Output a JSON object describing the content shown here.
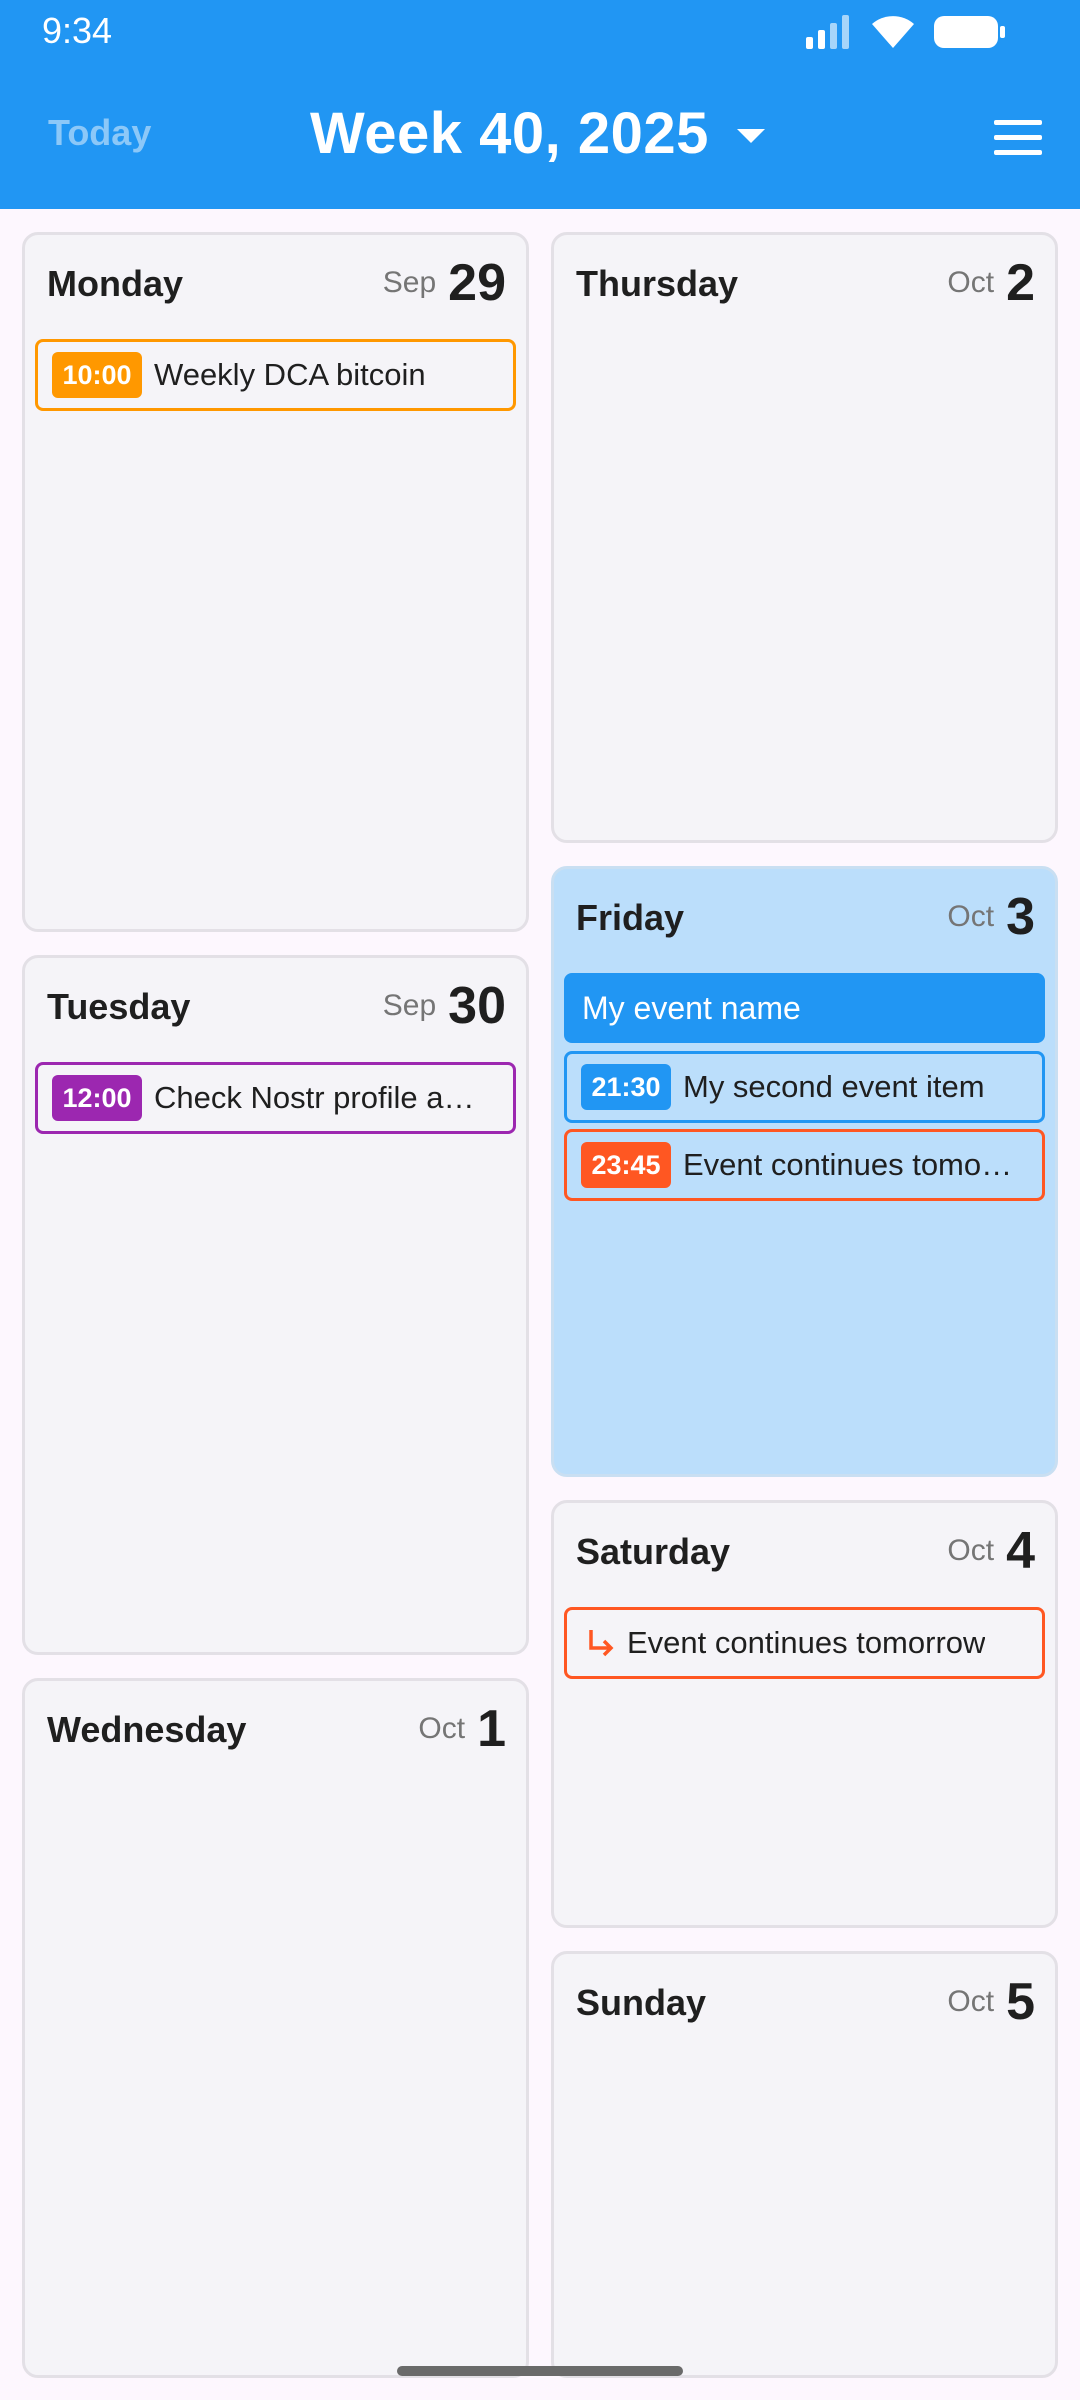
{
  "status_bar": {
    "time": "9:34"
  },
  "header": {
    "today_label": "Today",
    "week_title": "Week 40, 2025",
    "accent_color": "#2196f3"
  },
  "days": [
    {
      "name": "Monday",
      "month": "Sep",
      "day": "29",
      "events": [
        {
          "time": "10:00",
          "title": "Weekly DCA bitcoin",
          "color": "#ff9800"
        }
      ]
    },
    {
      "name": "Tuesday",
      "month": "Sep",
      "day": "30",
      "events": [
        {
          "time": "12:00",
          "title": "Check Nostr profile a…",
          "color": "#9c27b0"
        }
      ]
    },
    {
      "name": "Wednesday",
      "month": "Oct",
      "day": "1",
      "events": []
    },
    {
      "name": "Thursday",
      "month": "Oct",
      "day": "2",
      "events": []
    },
    {
      "name": "Friday",
      "month": "Oct",
      "day": "3",
      "is_today": true,
      "events": [
        {
          "all_day": true,
          "title": "My event name",
          "color": "#2196f3"
        },
        {
          "time": "21:30",
          "title": "My second event item",
          "color": "#2196f3"
        },
        {
          "time": "23:45",
          "title": "Event continues tomo…",
          "color": "#ff5722"
        }
      ]
    },
    {
      "name": "Saturday",
      "month": "Oct",
      "day": "4",
      "events": [
        {
          "continuation": true,
          "title": "Event continues tomorrow",
          "color": "#ff5722",
          "icon": "subdirectory-arrow-icon"
        }
      ]
    },
    {
      "name": "Sunday",
      "month": "Oct",
      "day": "5",
      "events": []
    }
  ]
}
